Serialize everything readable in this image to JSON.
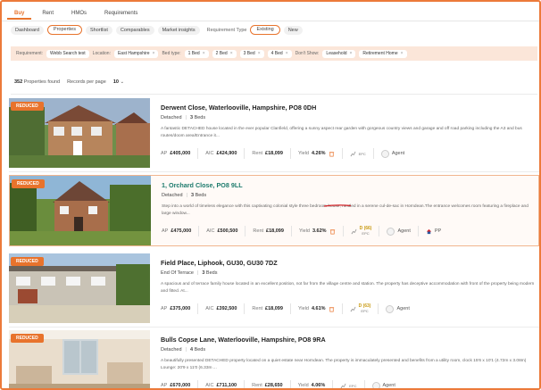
{
  "top_tabs": [
    "Buy",
    "Rent",
    "HMOs",
    "Requirements"
  ],
  "sub_tabs": [
    "Dashboard",
    "Properties",
    "Shortlist",
    "Comparables",
    "Market insights"
  ],
  "requirement_type": {
    "label": "Requirement Type",
    "options": [
      "Existing",
      "New"
    ]
  },
  "filters": {
    "requirement_label": "Requirement:",
    "requirement_value": "Webb Search test",
    "location_label": "Location:",
    "location_value": "East Hampshire",
    "bedtype_label": "Bed type:",
    "bedtypes": [
      "1 Bed",
      "2 Bed",
      "3 Bed",
      "4 Bed"
    ],
    "dontshow_label": "Don't Show:",
    "dontshow": [
      "Leasehold",
      "Retirement Home"
    ],
    "remove_symbol": "×"
  },
  "results": {
    "count": "352",
    "count_label": "Properties found",
    "per_page_label": "Records per page",
    "per_page_value": "10"
  },
  "listings": [
    {
      "badge": "REDUCED",
      "title": "Derwent Close, Waterlooville, Hampshire, PO8 0DH",
      "type": "Detached",
      "beds_num": "3",
      "beds_label": "Beds",
      "description": "A fantastic DETACHED house located in the ever popular Clanfield, offering a sunny aspect rear garden with gorgeous country views and garage and off road parking including the A3 and bus routes/doom area/Entrance it...",
      "ap": "£405,000",
      "aic": "£424,900",
      "rent": "£18,099",
      "yield": "4.26%",
      "epc": "EPC",
      "epc_grade": "",
      "agent": "Agent",
      "extra": ""
    },
    {
      "badge": "REDUCED",
      "title": "1, Orchard Close, PO8 9LL",
      "type": "Detached",
      "beds_num": "3",
      "beds_label": "Beds",
      "description": "Step into a world of timeless elegance with this captivating colonial style three bedroom house, nestled in a serene cul-de-sac in Horndean.The entrance welcomes room featuring a fireplace and large window...",
      "ap": "£475,000",
      "aic": "£500,500",
      "rent": "£18,099",
      "yield": "3.62%",
      "epc": "EPC",
      "epc_grade": "D (66)",
      "agent": "Agent",
      "extra": "PP"
    },
    {
      "badge": "REDUCED",
      "title": "Field Place, Liphook, GU30, GU30 7DZ",
      "type": "End Of Terrace",
      "beds_num": "3",
      "beds_label": "Beds",
      "description": "A spacious and of terrace family house located in an excellent position, not far from the village centre and station. The property has deceptive accommodation with front of the property being modern and fitted. At...",
      "ap": "£375,000",
      "aic": "£392,500",
      "rent": "£18,099",
      "yield": "4.61%",
      "epc": "EPC",
      "epc_grade": "D (63)",
      "agent": "Agent",
      "extra": ""
    },
    {
      "badge": "REDUCED",
      "title": "Bulls Copse Lane, Waterlooville, Hampshire, PO8 9RA",
      "type": "Detached",
      "beds_num": "4",
      "beds_label": "Beds",
      "description": "A beautifully presented DETACHED property located on a quiet estate near Horndean. The property is immaculately presented and benefits from a utility room, clock 15'6 x 10'1 (4.72m x 3.08m) Lounge: 20'9 x 11'0 (6.33m ...",
      "ap": "£670,000",
      "aic": "£711,100",
      "rent": "£28,650",
      "yield": "4.06%",
      "epc": "EPC",
      "epc_grade": "",
      "agent": "Agent",
      "extra": ""
    }
  ],
  "stat_labels": {
    "ap": "AP",
    "aic": "AIC",
    "rent": "Rent",
    "yield": "Yield"
  },
  "colors": {
    "accent": "#e8732c",
    "teal": "#1d7b6d",
    "highlight_bg": "#fbe6d9"
  }
}
